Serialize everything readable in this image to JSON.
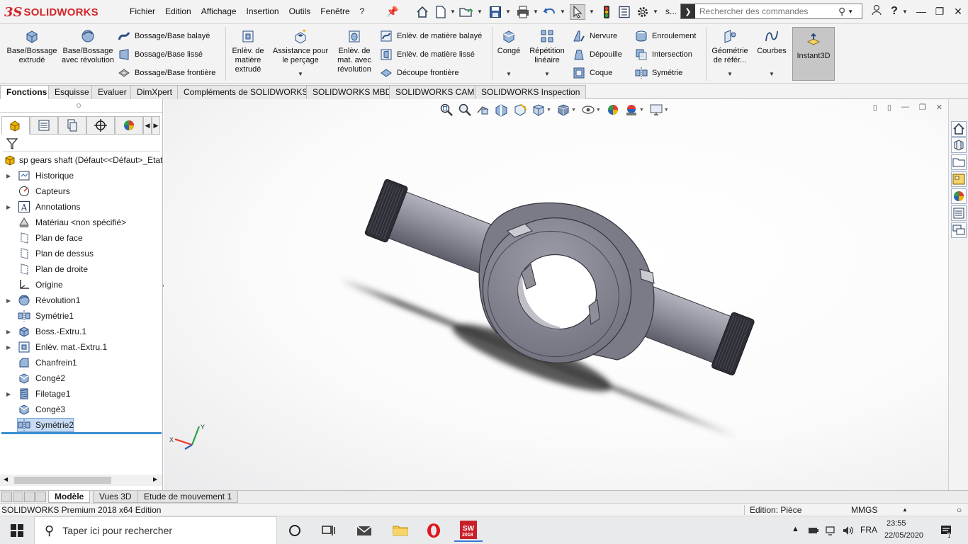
{
  "app": {
    "brand_ds": "3S",
    "brand_name": "SOLIDWORKS"
  },
  "menu": [
    "Fichier",
    "Edition",
    "Affichage",
    "Insertion",
    "Outils",
    "Fenêtre",
    "?"
  ],
  "quick_access_truncated": "s...",
  "search": {
    "placeholder": "Rechercher des commandes"
  },
  "command_manager": {
    "extrude_boss": "Base/Bossage extrudé",
    "revolve_boss": "Base/Bossage avec révolution",
    "swept_boss": "Bossage/Base balayé",
    "loft_boss": "Bossage/Base lissé",
    "boundary_boss": "Bossage/Base frontière",
    "extrude_cut": "Enlèv. de matière extrudé",
    "hole_wizard": "Assistance pour le perçage",
    "revolve_cut": "Enlèv. de mat. avec révolution",
    "swept_cut": "Enlèv. de matière balayé",
    "loft_cut": "Enlèv. de matière lissé",
    "boundary_cut": "Découpe frontière",
    "fillet": "Congé",
    "linear_pattern": "Répétition linéaire",
    "rib": "Nervure",
    "draft": "Dépouille",
    "shell": "Coque",
    "wrap": "Enroulement",
    "intersect": "Intersection",
    "mirror": "Symétrie",
    "ref_geometry": "Géométrie de référ...",
    "curves": "Courbes",
    "instant3d": "Instant3D"
  },
  "tabs": [
    {
      "label": "Fonctions",
      "active": true
    },
    {
      "label": "Esquisse"
    },
    {
      "label": "Evaluer"
    },
    {
      "label": "DimXpert"
    },
    {
      "label": "Compléments de SOLIDWORKS"
    },
    {
      "label": "SOLIDWORKS MBD"
    },
    {
      "label": "SOLIDWORKS CAM"
    },
    {
      "label": "SOLIDWORKS Inspection"
    }
  ],
  "feature_tree": {
    "root": "sp gears shaft  (Défaut<<Défaut>_Etat",
    "items": [
      {
        "label": "Historique",
        "icon": "history-icon",
        "expandable": true
      },
      {
        "label": "Capteurs",
        "icon": "sensor-icon",
        "expandable": false
      },
      {
        "label": "Annotations",
        "icon": "annotation-icon",
        "expandable": true
      },
      {
        "label": "Matériau <non spécifié>",
        "icon": "material-icon",
        "expandable": false
      },
      {
        "label": "Plan de face",
        "icon": "plane-icon",
        "expandable": false
      },
      {
        "label": "Plan de dessus",
        "icon": "plane-icon",
        "expandable": false
      },
      {
        "label": "Plan de droite",
        "icon": "plane-icon",
        "expandable": false
      },
      {
        "label": "Origine",
        "icon": "origin-icon",
        "expandable": false
      },
      {
        "label": "Révolution1",
        "icon": "revolve-icon",
        "expandable": true
      },
      {
        "label": "Symétrie1",
        "icon": "mirror-icon",
        "expandable": false
      },
      {
        "label": "Boss.-Extru.1",
        "icon": "extrude-icon",
        "expandable": true
      },
      {
        "label": "Enlèv. mat.-Extru.1",
        "icon": "cut-icon",
        "expandable": true
      },
      {
        "label": "Chanfrein1",
        "icon": "chamfer-icon",
        "expandable": false
      },
      {
        "label": "Congé2",
        "icon": "fillet-icon",
        "expandable": false
      },
      {
        "label": "Filetage1",
        "icon": "thread-icon",
        "expandable": true
      },
      {
        "label": "Congé3",
        "icon": "fillet-icon",
        "expandable": false
      },
      {
        "label": "Symétrie2",
        "icon": "mirror-icon",
        "expandable": false,
        "selected": true
      }
    ]
  },
  "bottom_tabs": [
    {
      "label": "Modèle",
      "active": true
    },
    {
      "label": "Vues 3D"
    },
    {
      "label": "Etude de mouvement 1"
    }
  ],
  "status": {
    "edition": "SOLIDWORKS Premium 2018 x64 Edition",
    "mode": "Edition: Pièce",
    "units": "MMGS"
  },
  "taskbar": {
    "search_placeholder": "Taper ici pour rechercher",
    "language": "FRA",
    "time": "23:55",
    "date": "22/05/2020",
    "sw_badge": "2018",
    "notification_count": "1"
  },
  "colors": {
    "brand": "#d2262a",
    "selection": "#c7dcf4",
    "model": "#8d8e98"
  }
}
